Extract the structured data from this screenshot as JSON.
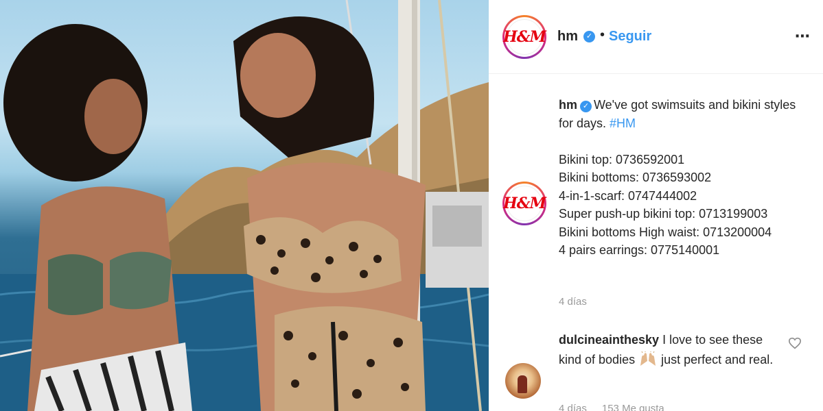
{
  "post": {
    "account": {
      "logo_text": "H&M",
      "username": "hm",
      "separator": "•",
      "follow_label": "Seguir",
      "more_icon": "⋯"
    },
    "caption": {
      "username": "hm",
      "text": "We've got swimsuits and bikini styles for days.",
      "hashtag": "#HM",
      "lines": [
        "Bikini top: 0736592001",
        "Bikini bottoms: 0736593002",
        "4-in-1-scarf: 0747444002",
        "Super push-up bikini top: 0713199003",
        "Bikini bottoms High waist: 0713200004",
        "4 pairs earrings: 0775140001"
      ],
      "time": "4 días"
    },
    "comment": {
      "username": "dulcineainthesky",
      "text_before": "I love to see these kind of bodies",
      "text_after": "just perfect and real.",
      "time": "4 días",
      "likes": "153 Me gusta"
    }
  },
  "colors": {
    "accent": "#3897f0",
    "text": "#262626",
    "muted": "#999999",
    "brand_red": "#e50010"
  }
}
